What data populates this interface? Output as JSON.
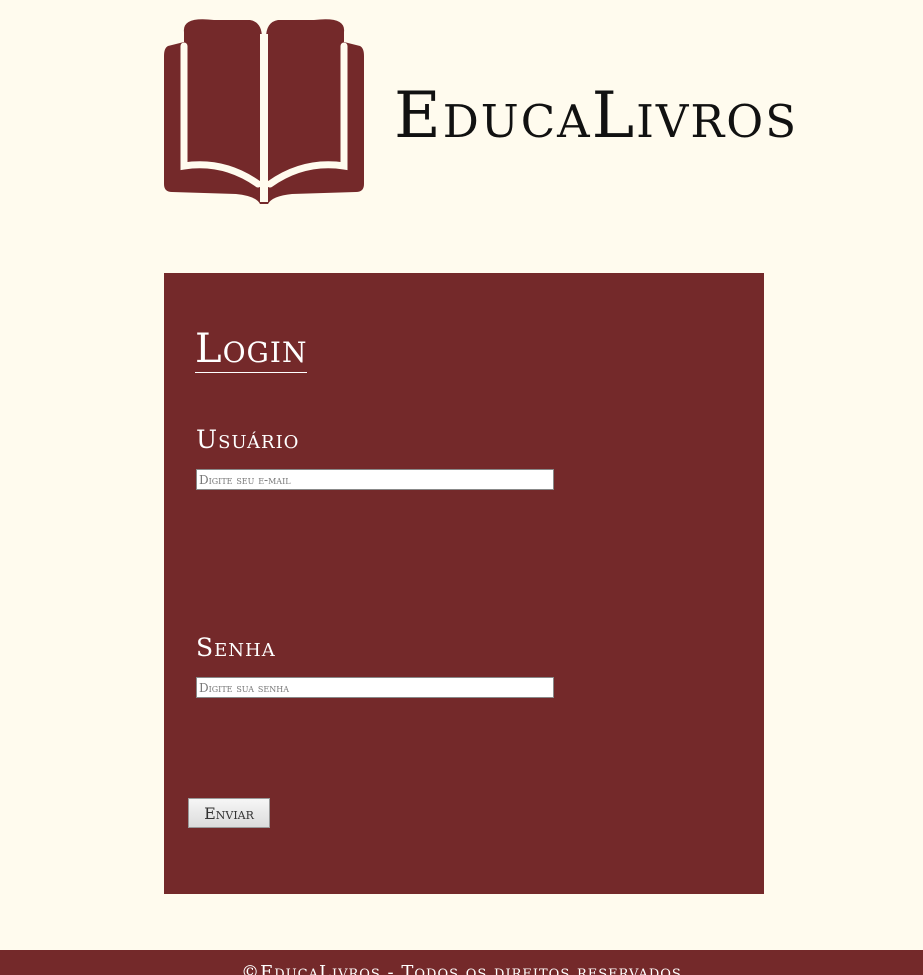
{
  "header": {
    "logo_icon": "open-book-icon",
    "brand_name": "EducaLivros"
  },
  "login": {
    "title": "Login",
    "username_label": "Usuário",
    "username_placeholder": "Digite seu e-mail",
    "password_label": "Senha",
    "password_placeholder": "Digite sua senha",
    "submit_label": "Enviar"
  },
  "footer": {
    "text": "©EducaLivros - Todos os direitos reservados"
  },
  "colors": {
    "background": "#fffbee",
    "brand": "#74292a",
    "text_light": "#ffffff"
  }
}
